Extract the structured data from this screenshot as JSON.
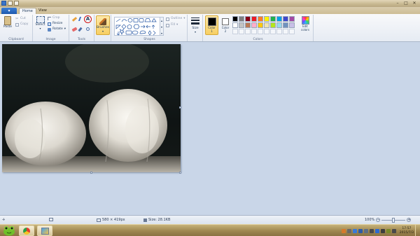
{
  "window": {
    "controls": [
      "–",
      "□",
      "✕"
    ]
  },
  "menu": {
    "file_label": "▾",
    "tabs": [
      "Home",
      "View"
    ]
  },
  "ribbon": {
    "clipboard": {
      "paste": "Paste",
      "cut": "Cut",
      "copy": "Copy",
      "label": "Clipboard"
    },
    "image": {
      "select": "Select",
      "crop": "Crop",
      "resize": "Resize",
      "rotate": "Rotate",
      "label": "Image"
    },
    "tools": {
      "label": "Tools"
    },
    "brushes": {
      "label": "Brushes"
    },
    "shapes": {
      "outline": "Outline",
      "fill": "Fill",
      "label": "Shapes"
    },
    "size": {
      "label": "Size"
    },
    "colors": {
      "color1": "Color 1",
      "color2": "Color 2",
      "edit": "Edit colors",
      "label": "Colors",
      "palette_top": [
        "#000000",
        "#7f7f7f",
        "#880015",
        "#ed1c24",
        "#ff7f27",
        "#fff200",
        "#22b14c",
        "#00a2e8",
        "#3f48cc",
        "#a349a4"
      ],
      "palette_bottom": [
        "#ffffff",
        "#c3c3c3",
        "#b97a57",
        "#ffaec9",
        "#ffc90e",
        "#efe4b0",
        "#b5e61d",
        "#99d9ea",
        "#7092be",
        "#c8bfe7"
      ],
      "active_color1": "#000000",
      "active_color2": "#ffffff"
    }
  },
  "status": {
    "dimensions": "580 × 419px",
    "size": "Size: 28.1KB",
    "zoom": "100%"
  },
  "taskbar": {
    "time": "17:57",
    "date": "2015/7/3"
  }
}
